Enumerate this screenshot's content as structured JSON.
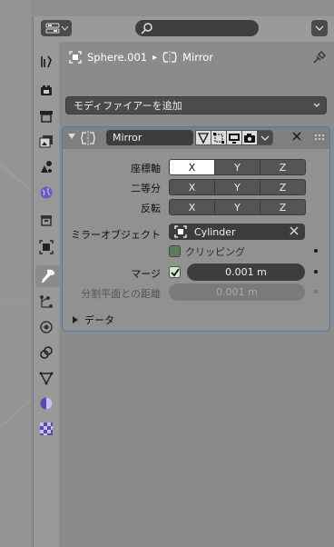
{
  "header": {
    "editor_type_icon": "properties-editor-icon",
    "search_icon": "search-icon",
    "search_placeholder": "",
    "options_icon": "chevron-down-icon"
  },
  "tabs": [
    {
      "name": "tool",
      "icon": "tool-icon"
    },
    {
      "name": "render",
      "icon": "render-icon"
    },
    {
      "name": "output",
      "icon": "output-icon"
    },
    {
      "name": "view-layer",
      "icon": "view-layer-icon"
    },
    {
      "name": "scene",
      "icon": "scene-icon"
    },
    {
      "name": "world",
      "icon": "world-icon"
    },
    {
      "name": "collection",
      "icon": "collection-icon"
    },
    {
      "name": "object",
      "icon": "object-icon"
    },
    {
      "name": "modifiers",
      "icon": "wrench-icon",
      "active": true
    },
    {
      "name": "particles",
      "icon": "particles-icon"
    },
    {
      "name": "physics",
      "icon": "physics-icon"
    },
    {
      "name": "constraints",
      "icon": "constraints-icon"
    },
    {
      "name": "data",
      "icon": "mesh-data-icon"
    },
    {
      "name": "material",
      "icon": "material-icon"
    },
    {
      "name": "texture",
      "icon": "texture-icon"
    }
  ],
  "breadcrumb": {
    "object_name": "Sphere.001",
    "separator": "▸",
    "modifier_name": "Mirror"
  },
  "add_modifier": {
    "label": "モディファイアーを追加"
  },
  "modifier": {
    "name": "Mirror",
    "axis": {
      "label": "座標軸",
      "options": [
        "X",
        "Y",
        "Z"
      ],
      "active": [
        true,
        false,
        false
      ]
    },
    "bisect": {
      "label": "二等分",
      "options": [
        "X",
        "Y",
        "Z"
      ],
      "active": [
        false,
        false,
        false
      ]
    },
    "flip": {
      "label": "反転",
      "options": [
        "X",
        "Y",
        "Z"
      ],
      "active": [
        false,
        false,
        false
      ]
    },
    "mirror_object": {
      "label": "ミラーオブジェクト",
      "value": "Cylinder"
    },
    "clipping": {
      "label": "クリッピング",
      "checked": false
    },
    "merge": {
      "label": "マージ",
      "checked": true,
      "value": "0.001 m"
    },
    "bisect_distance": {
      "label": "分割平面との距離",
      "value": "0.001 m"
    },
    "data_panel": {
      "label": "データ"
    }
  },
  "colors": {
    "accent_border": "#4a7ab8",
    "panel_bg": "#919191",
    "field_bg": "#3d3d3d"
  }
}
